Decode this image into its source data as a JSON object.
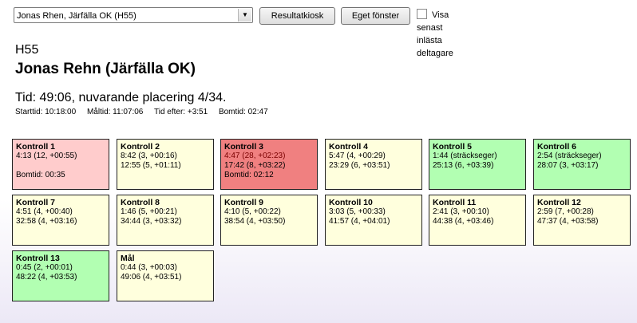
{
  "toolbar": {
    "runner_select": "Jonas Rhen, Järfälla OK (H55)",
    "resultatkiosk": "Resultatkiosk",
    "eget_fonster": "Eget fönster",
    "visa_senast": "Visa senast inlästa deltagare"
  },
  "header": {
    "class": "H55",
    "name": "Jonas Rehn (Järfälla OK)",
    "tid": "Tid: 49:06, nuvarande placering 4/34.",
    "starttid": "Starttid: 10:18:00",
    "maltid": "Måltid: 11:07:06",
    "tid_efter": "Tid efter: +3:51",
    "bomtid": "Bomtid: 02:47"
  },
  "colors": {
    "pink": "#ffcccc",
    "red": "#f08080",
    "green": "#b2ffb2",
    "yellow": "#ffffdd"
  },
  "controls": [
    {
      "title": "Kontroll 1",
      "split": "4:13 (12, +00:55)",
      "total": "",
      "bom": "Bomtid: 00:35",
      "color": "pink"
    },
    {
      "title": "Kontroll 2",
      "split": "8:42 (3, +00:16)",
      "total": "12:55 (5, +01:11)",
      "bom": "",
      "color": "yellow"
    },
    {
      "title": "Kontroll 3",
      "split": "4:47 (28, +02:23)",
      "total": "17:42 (8, +03:22)",
      "bom": "Bomtid: 02:12",
      "color": "red"
    },
    {
      "title": "Kontroll 4",
      "split": "5:47 (4, +00:29)",
      "total": "23:29 (6, +03:51)",
      "bom": "",
      "color": "yellow"
    },
    {
      "title": "Kontroll 5",
      "split": "1:44 (sträckseger)",
      "total": "25:13 (6, +03:39)",
      "bom": "",
      "color": "green"
    },
    {
      "title": "Kontroll 6",
      "split": "2:54 (sträckseger)",
      "total": "28:07 (3, +03:17)",
      "bom": "",
      "color": "green"
    },
    {
      "title": "Kontroll 7",
      "split": "4:51 (4, +00:40)",
      "total": "32:58 (4, +03:16)",
      "bom": "",
      "color": "yellow"
    },
    {
      "title": "Kontroll 8",
      "split": "1:46 (5, +00:21)",
      "total": "34:44 (3, +03:32)",
      "bom": "",
      "color": "yellow"
    },
    {
      "title": "Kontroll 9",
      "split": "4:10 (5, +00:22)",
      "total": "38:54 (4, +03:50)",
      "bom": "",
      "color": "yellow"
    },
    {
      "title": "Kontroll 10",
      "split": "3:03 (5, +00:33)",
      "total": "41:57 (4, +04:01)",
      "bom": "",
      "color": "yellow"
    },
    {
      "title": "Kontroll 11",
      "split": "2:41 (3, +00:10)",
      "total": "44:38 (4, +03:46)",
      "bom": "",
      "color": "yellow"
    },
    {
      "title": "Kontroll 12",
      "split": "2:59 (7, +00:28)",
      "total": "47:37 (4, +03:58)",
      "bom": "",
      "color": "yellow"
    },
    {
      "title": "Kontroll 13",
      "split": "0:45 (2, +00:01)",
      "total": "48:22 (4, +03:53)",
      "bom": "",
      "color": "green"
    },
    {
      "title": "Mål",
      "split": "0:44 (3, +00:03)",
      "total": "49:06 (4, +03:51)",
      "bom": "",
      "color": "yellow"
    }
  ]
}
